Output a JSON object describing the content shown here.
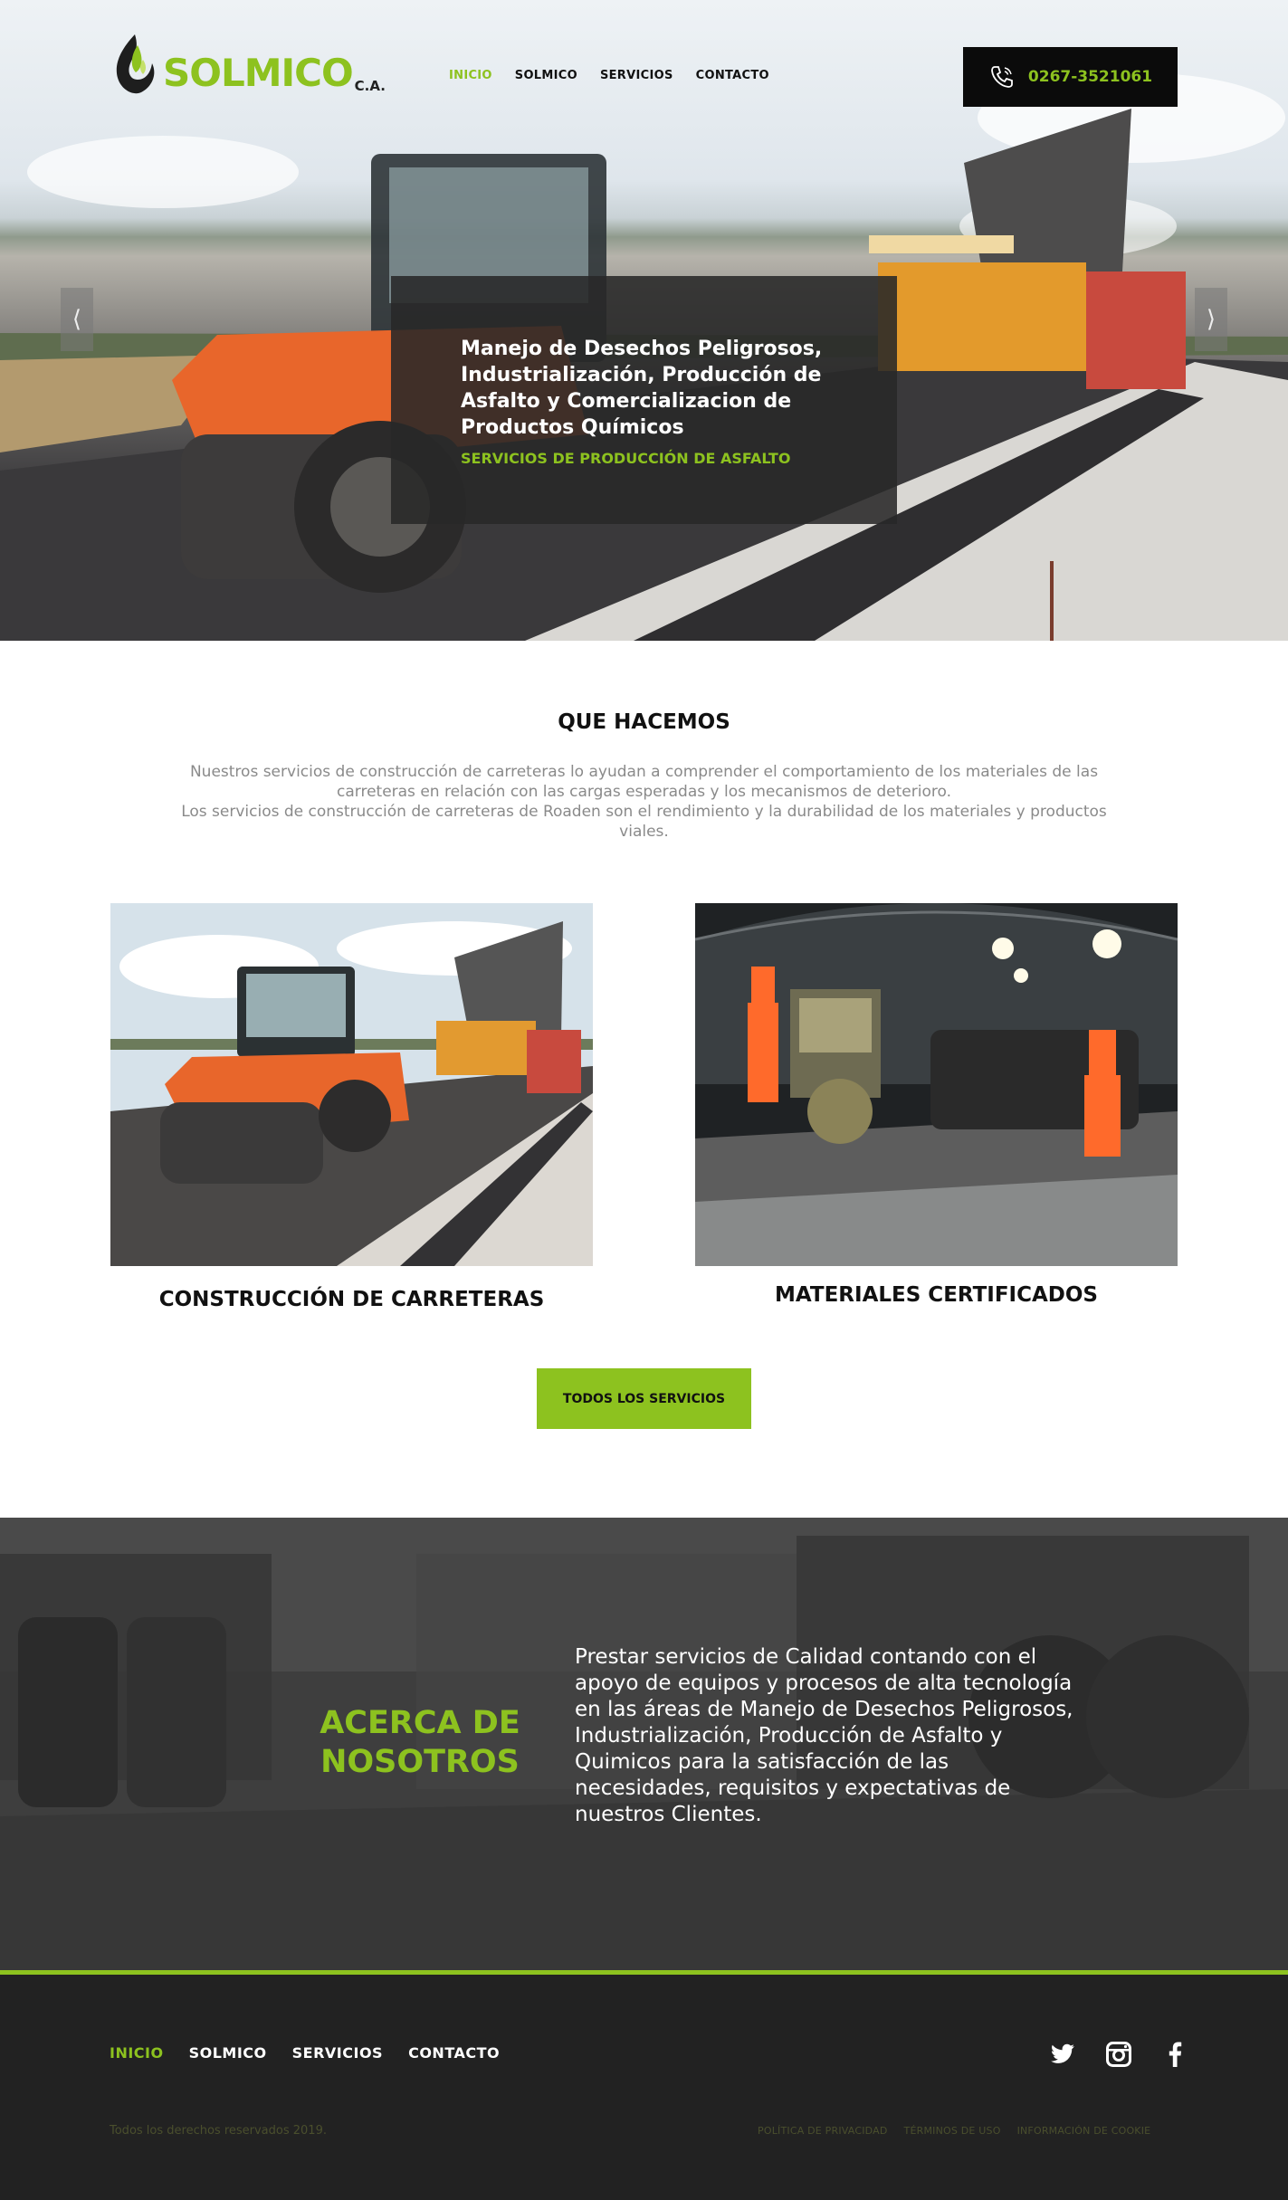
{
  "brand": {
    "name": "SOLMICO",
    "suffix": "C.A."
  },
  "nav": [
    {
      "label": "INICIO"
    },
    {
      "label": "SOLMICO"
    },
    {
      "label": "SERVICIOS"
    },
    {
      "label": "CONTACTO"
    }
  ],
  "phone": {
    "number": "0267-3521061",
    "icon": "phone-icon"
  },
  "hero": {
    "heading": "Manejo de Desechos Peligrosos, Industrialización, Producción de Asfalto y Comercializacion de Productos Químicos",
    "subheading": "SERVICIOS DE PRODUCCIÓN DE ASFALTO",
    "prev_icon": "chevron-left-icon",
    "next_icon": "chevron-right-icon"
  },
  "services": {
    "title": "QUE HACEMOS",
    "intro_1": "Nuestros servicios de construcción de carreteras lo ayudan a comprender el comportamiento de los materiales de las carreteras en relación con las cargas esperadas y los mecanismos de deterioro.",
    "intro_2": "Los servicios de construcción de carreteras de Roaden son el rendimiento y la durabilidad de los materiales y productos viales.",
    "cards": [
      {
        "title": "CONSTRUCCIÓN DE CARRETERAS"
      },
      {
        "title": "MATERIALES CERTIFICADOS"
      }
    ],
    "button": "TODOS LOS SERVICIOS"
  },
  "about": {
    "title_1": "ACERCA DE",
    "title_2": "NOSOTROS",
    "text": "Prestar servicios de Calidad contando con el apoyo de equipos y procesos de alta tecnología en las áreas de Manejo de Desechos Peligrosos, Industrialización, Producción de Asfalto y Quimicos para la satisfacción de las necesidades, requisitos y expectativas de nuestros Clientes."
  },
  "footer": {
    "nav": [
      {
        "label": "INICIO"
      },
      {
        "label": "SOLMICO"
      },
      {
        "label": "SERVICIOS"
      },
      {
        "label": "CONTACTO"
      }
    ],
    "social": [
      "twitter-icon",
      "instagram-icon",
      "facebook-icon"
    ],
    "copyright": "Todos los derechos reservados 2019.",
    "legal": [
      {
        "label": "POLÍTICA DE PRIVACIDAD"
      },
      {
        "label": "TÉRMINOS DE USO"
      },
      {
        "label": "INFORMACIÓN DE COOKIE"
      }
    ]
  },
  "colors": {
    "accent": "#8dc21f",
    "dark": "#222222",
    "black": "#0b0b0b"
  }
}
